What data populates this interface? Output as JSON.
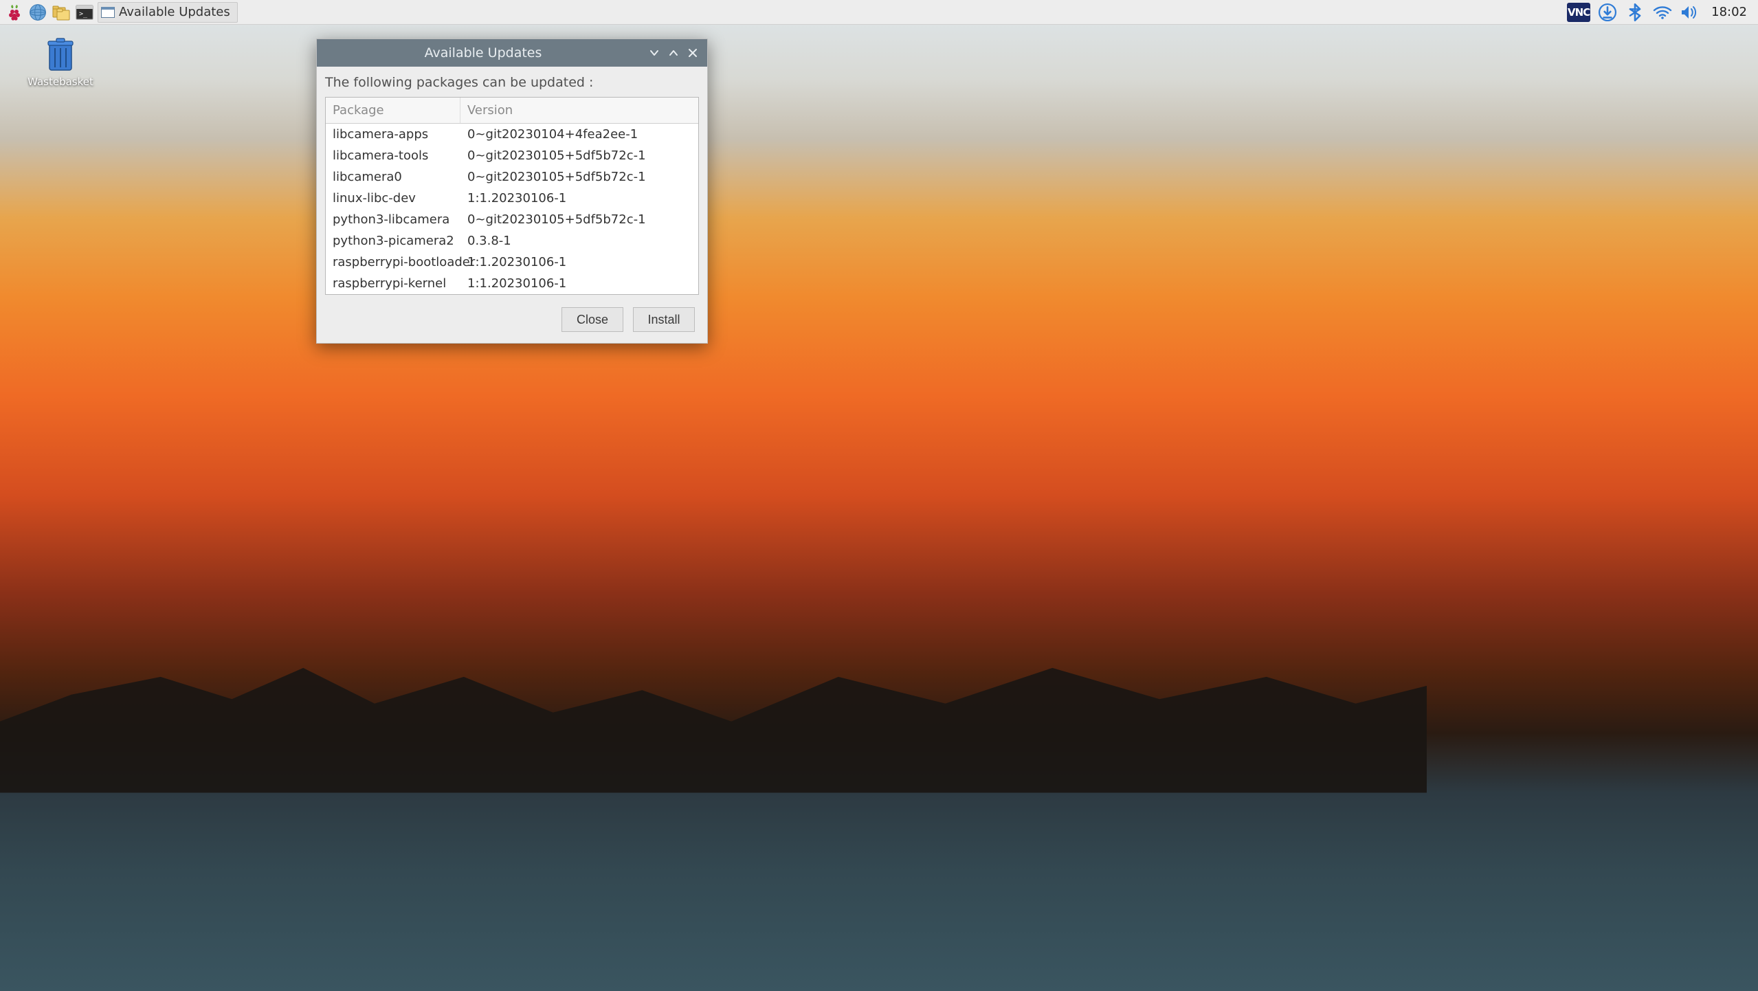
{
  "taskbar": {
    "menu_icon": "raspberry-pi-icon",
    "launchers": [
      {
        "name": "web-browser",
        "icon": "globe-icon"
      },
      {
        "name": "file-manager",
        "icon": "folders-icon"
      },
      {
        "name": "terminal",
        "icon": "terminal-icon"
      }
    ],
    "task_entry": {
      "app": "Available Updates",
      "label": "Available Updates"
    },
    "tray": {
      "vnc_label": "VNC",
      "items": [
        {
          "name": "vnc",
          "icon": "vnc-icon"
        },
        {
          "name": "updates",
          "icon": "download-icon"
        },
        {
          "name": "bluetooth",
          "icon": "bluetooth-icon"
        },
        {
          "name": "wifi",
          "icon": "wifi-icon"
        },
        {
          "name": "volume",
          "icon": "volume-icon"
        }
      ],
      "clock": "18:02"
    }
  },
  "desktop": {
    "wastebasket_label": "Wastebasket"
  },
  "dialog": {
    "title": "Available Updates",
    "message": "The following packages can be updated :",
    "columns": {
      "package": "Package",
      "version": "Version"
    },
    "packages": [
      {
        "name": "libcamera-apps",
        "version": "0~git20230104+4fea2ee-1"
      },
      {
        "name": "libcamera-tools",
        "version": "0~git20230105+5df5b72c-1"
      },
      {
        "name": "libcamera0",
        "version": "0~git20230105+5df5b72c-1"
      },
      {
        "name": "linux-libc-dev",
        "version": "1:1.20230106-1"
      },
      {
        "name": "python3-libcamera",
        "version": "0~git20230105+5df5b72c-1"
      },
      {
        "name": "python3-picamera2",
        "version": "0.3.8-1"
      },
      {
        "name": "raspberrypi-bootloader",
        "version": "1:1.20230106-1"
      },
      {
        "name": "raspberrypi-kernel",
        "version": "1:1.20230106-1"
      }
    ],
    "buttons": {
      "close": "Close",
      "install": "Install"
    }
  }
}
